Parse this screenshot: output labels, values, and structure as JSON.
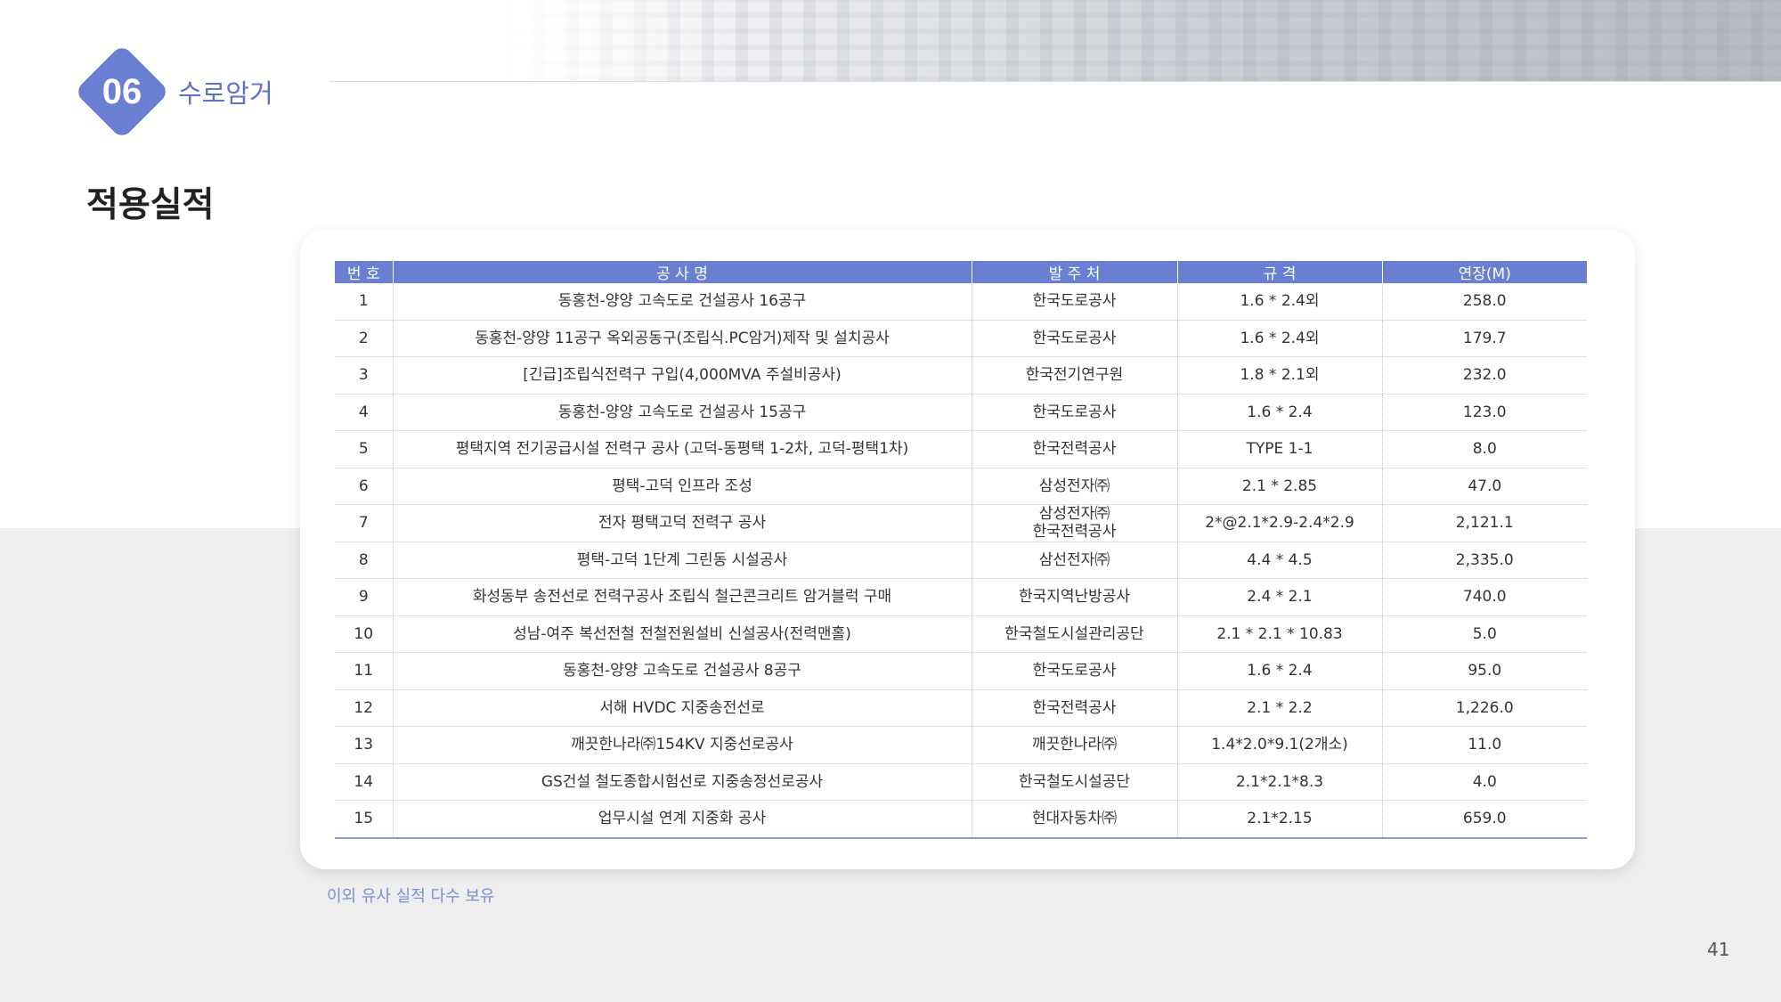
{
  "header": {
    "section_number": "06",
    "section_name": "수로암거"
  },
  "page_title": "적용실적",
  "table": {
    "columns": [
      "번 호",
      "공 사 명",
      "발 주 처",
      "규  격",
      "연장(M)"
    ],
    "rows": [
      [
        "1",
        "동홍천-양양 고속도로 건설공사 16공구",
        [
          "한국도로공사"
        ],
        "1.6 * 2.4외",
        "258.0"
      ],
      [
        "2",
        "동홍천-양양 11공구 옥외공동구(조립식.PC암거)제작 및 설치공사",
        [
          "한국도로공사"
        ],
        "1.6 * 2.4외",
        "179.7"
      ],
      [
        "3",
        "[긴급]조립식전력구 구입(4,000MVA 주설비공사)",
        [
          "한국전기연구원"
        ],
        "1.8 * 2.1외",
        "232.0"
      ],
      [
        "4",
        "동홍천-양양 고속도로 건설공사 15공구",
        [
          "한국도로공사"
        ],
        "1.6 * 2.4",
        "123.0"
      ],
      [
        "5",
        "평택지역 전기공급시설 전력구 공사 (고덕-동평택 1-2차, 고덕-평택1차)",
        [
          "한국전력공사"
        ],
        "TYPE 1-1",
        "8.0"
      ],
      [
        "6",
        "평택-고덕 인프라 조성",
        [
          "삼성전자㈜"
        ],
        "2.1 * 2.85",
        "47.0"
      ],
      [
        "7",
        "전자 평택고덕 전력구 공사",
        [
          "삼성전자㈜",
          "한국전력공사"
        ],
        "2*@2.1*2.9-2.4*2.9",
        "2,121.1"
      ],
      [
        "8",
        "평택-고덕 1단계 그린동 시설공사",
        [
          "삼선전자㈜"
        ],
        "4.4 * 4.5",
        "2,335.0"
      ],
      [
        "9",
        "화성동부 송전선로 전력구공사 조립식 철근콘크리트 암거블럭 구매",
        [
          "한국지역난방공사"
        ],
        "2.4 * 2.1",
        "740.0"
      ],
      [
        "10",
        "성남-여주 복선전철 전철전원설비 신설공사(전력맨홀)",
        [
          "한국철도시설관리공단"
        ],
        "2.1 * 2.1 * 10.83",
        "5.0"
      ],
      [
        "11",
        "동홍천-양양 고속도로 건설공사 8공구",
        [
          "한국도로공사"
        ],
        "1.6 * 2.4",
        "95.0"
      ],
      [
        "12",
        "서해 HVDC 지중송전선로",
        [
          "한국전력공사"
        ],
        "2.1 * 2.2",
        "1,226.0"
      ],
      [
        "13",
        "깨끗한나라㈜154KV 지중선로공사",
        [
          "깨끗한나라㈜"
        ],
        "1.4*2.0*9.1(2개소)",
        "11.0"
      ],
      [
        "14",
        "GS건설 철도종합시험선로 지중송정선로공사",
        [
          "한국철도시설공단"
        ],
        "2.1*2.1*8.3",
        "4.0"
      ],
      [
        "15",
        "업무시설 연계 지중화 공사",
        [
          "현대자동차㈜"
        ],
        "2.1*2.15",
        "659.0"
      ]
    ]
  },
  "footnote": "이외 유사 실적 다수 보유",
  "page_number": "41",
  "colors": {
    "accent": "#6a7fd1",
    "section_text": "#5d72c8",
    "footnote_text": "#7b8fd6",
    "band": "#eeeeee"
  }
}
